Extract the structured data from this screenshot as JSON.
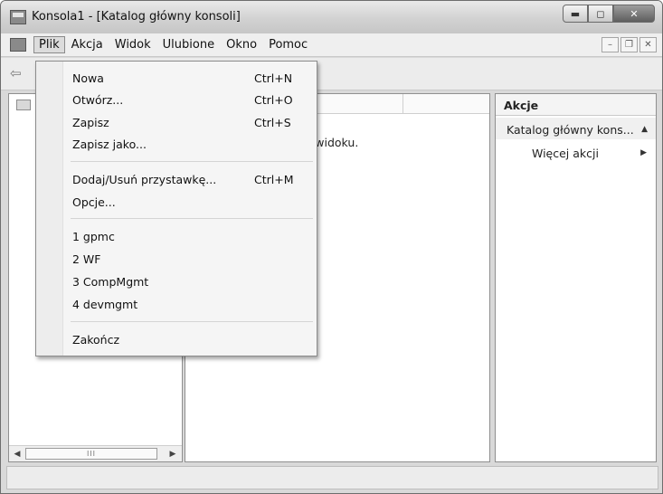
{
  "window": {
    "title": "Konsola1 - [Katalog główny konsoli]"
  },
  "menubar": {
    "items": [
      {
        "label": "Plik"
      },
      {
        "label": "Akcja"
      },
      {
        "label": "Widok"
      },
      {
        "label": "Ulubione"
      },
      {
        "label": "Okno"
      },
      {
        "label": "Pomoc"
      }
    ]
  },
  "file_menu": {
    "items": [
      {
        "label": "Nowa",
        "shortcut": "Ctrl+N"
      },
      {
        "label": "Otwórz...",
        "shortcut": "Ctrl+O"
      },
      {
        "label": "Zapisz",
        "shortcut": "Ctrl+S"
      },
      {
        "label": "Zapisz jako...",
        "shortcut": ""
      },
      {
        "label": "Dodaj/Usuń przystawkę...",
        "shortcut": "Ctrl+M"
      },
      {
        "label": "Opcje...",
        "shortcut": ""
      },
      {
        "label": "1 gpmc",
        "shortcut": ""
      },
      {
        "label": "2 WF",
        "shortcut": ""
      },
      {
        "label": "3 CompMgmt",
        "shortcut": ""
      },
      {
        "label": "4 devmgmt",
        "shortcut": ""
      },
      {
        "label": "Zakończ",
        "shortcut": ""
      }
    ]
  },
  "center": {
    "message": "wyświetlenia w tym widoku."
  },
  "actions": {
    "title": "Akcje",
    "section": "Katalog główny kons...",
    "more": "Więcej akcji"
  },
  "scroll": {
    "thumb_grip": "III"
  },
  "icons": {
    "app": "mmc-console-icon",
    "back": "back-arrow-icon",
    "collapse": "triangle-up-icon",
    "submenu": "triangle-right-icon"
  }
}
